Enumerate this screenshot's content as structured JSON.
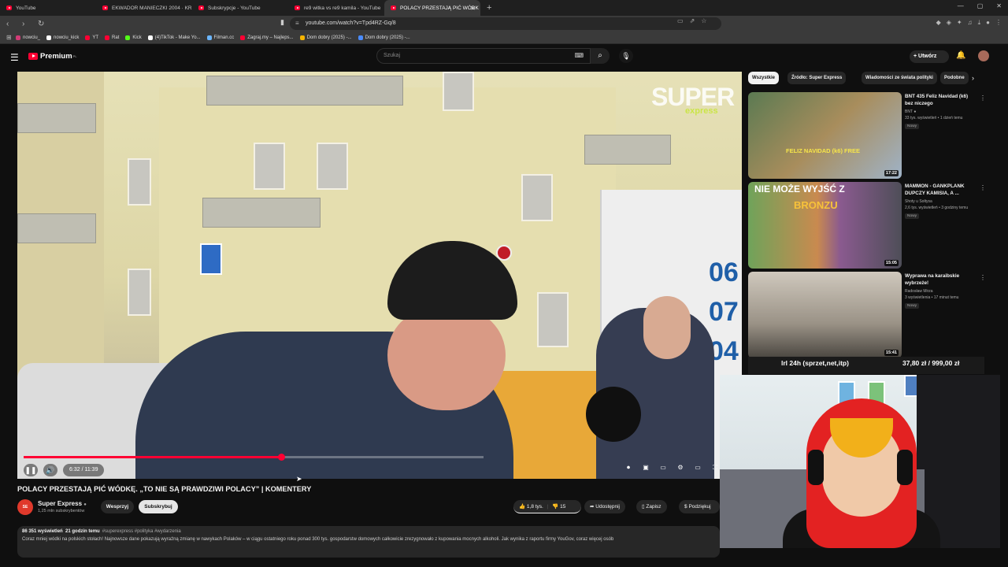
{
  "browser": {
    "tabs": [
      {
        "title": "YouTube"
      },
      {
        "title": "EKWADOR MANIECZKI 2004 · KR"
      },
      {
        "title": "Subskrypcje - YouTube"
      },
      {
        "title": "re9 witka vs re9 kamila - YouTube"
      },
      {
        "title": "POLACY PRZESTAJĄ PIĆ WÓDK",
        "active": true
      }
    ],
    "new_tab": "+",
    "url": "youtube.com/watch?v=Tpd4RZ-Gq/8",
    "bookmarks": [
      {
        "label": "nowciu_",
        "color": "#d23b76"
      },
      {
        "label": "nowciu_kick",
        "color": "#ffffff"
      },
      {
        "label": "YT",
        "color": "#ff0033"
      },
      {
        "label": "Rat",
        "color": "#ff0033"
      },
      {
        "label": "Kick",
        "color": "#53fc18"
      },
      {
        "label": "(4)TikTok - Make Yo...",
        "color": "#ffffff"
      },
      {
        "label": "Filman.cc",
        "color": "#6bb6ff"
      },
      {
        "label": "Zagraj.my – Najleps...",
        "color": "#ff0033"
      },
      {
        "label": "Dom dobry (2025) -...",
        "color": "#f5b400"
      },
      {
        "label": "Dom dobry (2025) -...",
        "color": "#4a8cff"
      }
    ]
  },
  "yt": {
    "logo": "Premium",
    "region": "PL",
    "search_placeholder": "Szukaj",
    "create_label": "Utwórz"
  },
  "video": {
    "watermark": "SUPER",
    "watermark2": "express",
    "time": "6:32 / 11:39",
    "progress": 0.56,
    "title": "POLACY PRZESTAJĄ PIĆ WÓDKĘ. „TO NIE SĄ PRAWDZIWI POLACY” | KOMENTERY",
    "channel": "Super Express",
    "subscribers": "1,25 mln subskrybentów",
    "support_label": "Wesprzyj",
    "subscribe_label": "Subskrybuj",
    "likes": "1,8 tys.",
    "dislikes": "15",
    "share_label": "Udostępnij",
    "save_label": "Zapisz",
    "thanks_label": "Podziękuj",
    "views": "86 351 wyświetleń",
    "ago": "21 godzin temu",
    "tags": "#superexpress #polityka #wydarzenia",
    "description": "Coraz mniej wódki na polskich stołach! Najnowsze dane pokazują wyraźną zmianę w nawykach Polaków – w ciągu ostatniego roku ponad 300 tys. gospodarstw domowych całkowicie zrezygnowało z kupowania mocnych alkoholi. Jak wynika z raportu firmy YouGov, coraz więcej osób"
  },
  "chips": [
    {
      "label": "Wszystkie",
      "selected": true
    },
    {
      "label": "Źródło: Super Express"
    },
    {
      "label": "Wiadomości ze świata polityki"
    },
    {
      "label": "Podobne"
    }
  ],
  "recommendations": [
    {
      "title": "BNT 435 Feliz Navidad (k6) bez niczego",
      "channel": "BNT",
      "meta": "33 tys. wyświetleń • 1 dzień temu",
      "badge": "Nowy",
      "duration": "17:22",
      "thumb_text": "FELIZ NAVIDAD (k6) FREE"
    },
    {
      "title": "MAMMON - GANKPLANK DUPCZY KAMISIA, A ...",
      "channel": "Shoty u Sołtysa",
      "meta": "2,6 tys. wyświetleń • 3 godziny temu",
      "badge": "Nowy",
      "duration": "15:05",
      "thumb_text": "NIE MOŻE WYJŚĆ Z",
      "thumb_text2": "BRONZU"
    },
    {
      "title": "Wyprawa na karaibskie wybrzeże!",
      "channel": "Radosław Mirza",
      "meta": "3 wyświetlenia • 17 minut temu",
      "badge": "Nowy",
      "duration": "15:41"
    }
  ],
  "stream_overlay": {
    "left": "lrl 24h (sprzet,net,itp)",
    "right": "37,80 zł / 999,00 zł"
  }
}
